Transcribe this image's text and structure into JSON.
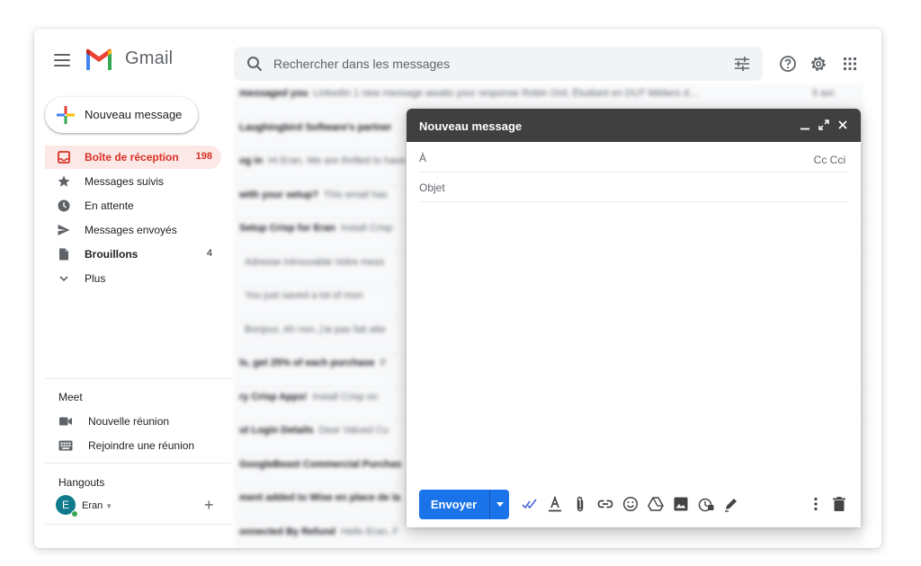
{
  "app": {
    "name": "Gmail"
  },
  "search": {
    "placeholder": "Rechercher dans les messages"
  },
  "compose_button": {
    "label": "Nouveau message"
  },
  "nav": {
    "inbox": {
      "label": "Boîte de réception",
      "count": "198"
    },
    "starred": {
      "label": "Messages suivis"
    },
    "snoozed": {
      "label": "En attente"
    },
    "sent": {
      "label": "Messages envoyés"
    },
    "drafts": {
      "label": "Brouillons",
      "count": "4"
    },
    "more": {
      "label": "Plus"
    }
  },
  "meet": {
    "title": "Meet",
    "new_meeting": "Nouvelle réunion",
    "join_meeting": "Rejoindre une réunion"
  },
  "hangouts": {
    "title": "Hangouts",
    "user_initial": "E",
    "user_name": "Eran",
    "presence_color": "#34a853"
  },
  "message_list": [
    {
      "subject": "messaged you",
      "preview": "LinkedIn 1 new message awaits your response Robin Ord, Étudiant en DUT Métiers d…",
      "date": "5 avr."
    },
    {
      "subject": "Laughingbird Software's partner",
      "preview": "",
      "date": ""
    },
    {
      "subject": "og in",
      "preview": "Hi Eran, We are thrilled to have you",
      "date": ""
    },
    {
      "subject": "with your setup?",
      "preview": "This email has",
      "date": ""
    },
    {
      "subject": "Setup Crisp for Eran",
      "preview": "Install Crisp",
      "date": ""
    },
    {
      "subject": "",
      "preview": "Adresse introuvable Votre mess",
      "date": ""
    },
    {
      "subject": "",
      "preview": "You just saved a lot of mon",
      "date": ""
    },
    {
      "subject": "",
      "preview": "Bonjour, Ah non, j'ai pas fait atte",
      "date": ""
    },
    {
      "subject": "ls, get 25% of each purchase",
      "preview": "If",
      "date": ""
    },
    {
      "subject": "ry Crisp Apps!",
      "preview": "Install Crisp on",
      "date": ""
    },
    {
      "subject": "ut Login Details",
      "preview": "Dear Valued Cu",
      "date": ""
    },
    {
      "subject": "GoogleBeast Commercial Purchas",
      "preview": "",
      "date": ""
    },
    {
      "subject": "ment added to Wise en place de la",
      "preview": "",
      "date": ""
    },
    {
      "subject": "onnected By Refund",
      "preview": "Hello Eran, F",
      "date": ""
    }
  ],
  "compose": {
    "title": "Nouveau message",
    "to_placeholder": "À",
    "cc_label": "Cc Cci",
    "subject_placeholder": "Objet",
    "send_label": "Envoyer"
  },
  "colors": {
    "accent": "#1a73e8",
    "inbox_active": "#d93025",
    "compose_header": "#404040"
  },
  "icons": {
    "toolbar": [
      "formatting-icon",
      "text-format-icon",
      "attach-icon",
      "link-icon",
      "emoji-icon",
      "drive-icon",
      "image-icon",
      "confidential-icon",
      "signature-icon"
    ]
  }
}
